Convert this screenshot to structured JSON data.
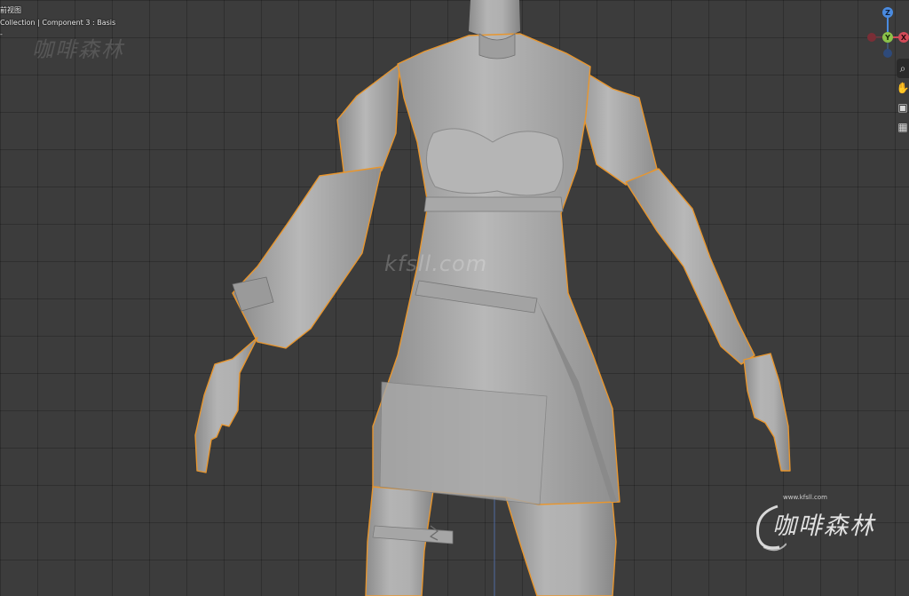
{
  "viewport": {
    "view_name": "前视图",
    "collection_info": "Collection | Component 3 : Basis",
    "frame_info": "‐",
    "selection_outline_color": "#e8962e",
    "grid_color": "#3c3c3c"
  },
  "gizmo": {
    "x_label": "X",
    "y_label": "Y",
    "z_label": "Z",
    "x_color": "#d24a58",
    "y_color": "#8bc34a",
    "z_color": "#4a8be0"
  },
  "nav_tools": [
    {
      "name": "zoom",
      "icon": "zoom-icon",
      "glyph": "⌕"
    },
    {
      "name": "pan",
      "icon": "hand-icon",
      "glyph": "✋"
    },
    {
      "name": "camera",
      "icon": "camera-icon",
      "glyph": "▣"
    },
    {
      "name": "perspective",
      "icon": "grid-icon",
      "glyph": "▦"
    }
  ],
  "watermarks": {
    "top_left": "咖啡森林",
    "center": "kfsll.com",
    "bottom_right_url": "www.kfsll.com",
    "bottom_right_name": "咖啡森林"
  }
}
